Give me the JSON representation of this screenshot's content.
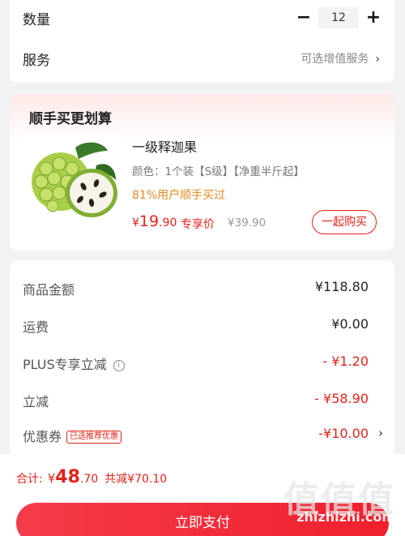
{
  "quantity": {
    "label": "数量",
    "minus": "−",
    "value": "12",
    "plus": "+"
  },
  "service": {
    "label": "服务",
    "value": "可选增值服务",
    "chevron": "›"
  },
  "bundle": {
    "title": "顺手买更划算",
    "product": {
      "name": "一级释迦果",
      "spec": "颜色：1个装【S级】【净重半斤起】",
      "promo": "81%用户顺手买过",
      "price_symbol": "¥",
      "price_int": "19",
      "price_dec": ".90",
      "exclusive_label": "专享价",
      "original_price": "¥39.90",
      "buy_button": "一起购买",
      "image_icon": "sugar-apple-image"
    }
  },
  "summary": {
    "rows": [
      {
        "label": "商品金额",
        "value": "¥118.80"
      },
      {
        "label": "运费",
        "value": "¥0.00"
      },
      {
        "label": "PLUS专享立减",
        "value": "- ¥1.20",
        "info": "i"
      },
      {
        "label": "立减",
        "value": "- ¥58.90"
      },
      {
        "label": "优惠券",
        "value": "-¥10.00",
        "tag": "已选推荐优惠",
        "chevron": "›"
      }
    ]
  },
  "footer": {
    "total_label": "合计:",
    "total_symbol": "¥",
    "total_int": "48",
    "total_dec": ".70",
    "saved": "共减¥70.10",
    "pay_button": "立即支付"
  },
  "watermark": {
    "glyph": "值值值",
    "url": "zhizhizhi.com"
  },
  "colors": {
    "accent": "#e2231a",
    "promo": "#e08a24",
    "background": "#f2f2f2"
  }
}
